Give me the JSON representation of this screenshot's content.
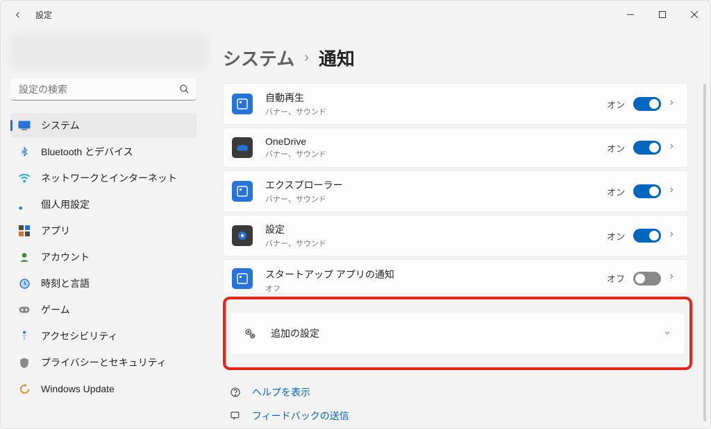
{
  "window": {
    "title": "設定"
  },
  "search": {
    "placeholder": "設定の検索"
  },
  "sidebar": {
    "items": [
      {
        "label": "システム",
        "icon": "🖥️",
        "active": true
      },
      {
        "label": "Bluetooth とデバイス",
        "icon": "bt"
      },
      {
        "label": "ネットワークとインターネット",
        "icon": "net"
      },
      {
        "label": "個人用設定",
        "icon": "brush"
      },
      {
        "label": "アプリ",
        "icon": "apps"
      },
      {
        "label": "アカウント",
        "icon": "acct"
      },
      {
        "label": "時刻と言語",
        "icon": "time"
      },
      {
        "label": "ゲーム",
        "icon": "game"
      },
      {
        "label": "アクセシビリティ",
        "icon": "access"
      },
      {
        "label": "プライバシーとセキュリティ",
        "icon": "shield"
      },
      {
        "label": "Windows Update",
        "icon": "update"
      }
    ]
  },
  "breadcrumb": {
    "parent": "システム",
    "separator": "›",
    "current": "通知"
  },
  "rows": [
    {
      "title": "自動再生",
      "sub": "バナー、サウンド",
      "state": "オン",
      "on": true,
      "iconBg": "ic-blue"
    },
    {
      "title": "OneDrive",
      "sub": "バナー、サウンド",
      "state": "オン",
      "on": true,
      "iconBg": "ic-dark"
    },
    {
      "title": "エクスプローラー",
      "sub": "バナー、サウンド",
      "state": "オン",
      "on": true,
      "iconBg": "ic-blue"
    },
    {
      "title": "設定",
      "sub": "バナー、サウンド",
      "state": "オン",
      "on": true,
      "iconBg": "ic-dark"
    },
    {
      "title": "スタートアップ アプリの通知",
      "sub": "オフ",
      "state": "オフ",
      "on": false,
      "iconBg": "ic-blue"
    }
  ],
  "extra": {
    "label": "追加の設定"
  },
  "helpers": {
    "help": "ヘルプを表示",
    "feedback": "フィードバックの送信"
  }
}
